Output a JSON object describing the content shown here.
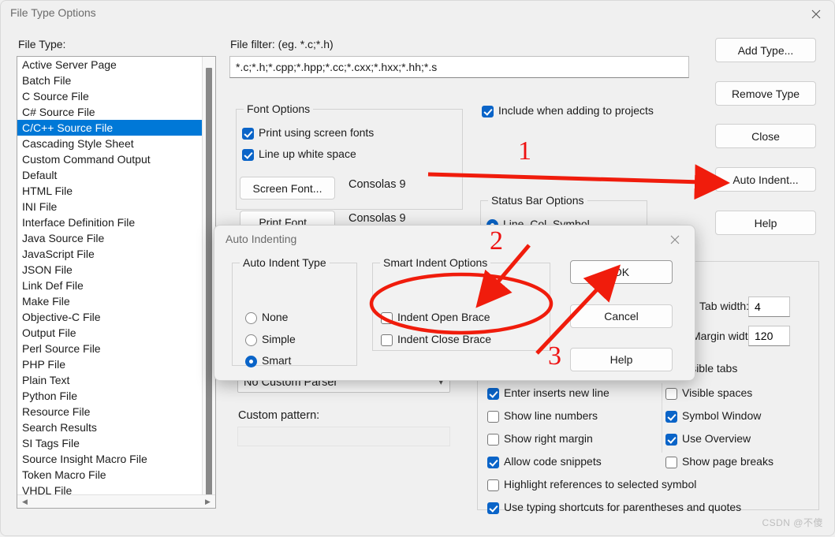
{
  "window": {
    "title": "File Type Options",
    "close_icon": "close-icon"
  },
  "file_type": {
    "label": "File Type:",
    "items": [
      "Active Server Page",
      "Batch File",
      "C Source File",
      "C# Source File",
      "C/C++ Source File",
      "Cascading Style Sheet",
      "Custom Command Output",
      "Default",
      "HTML File",
      "INI File",
      "Interface Definition File",
      "Java Source File",
      "JavaScript File",
      "JSON File",
      "Link Def File",
      "Make File",
      "Objective-C File",
      "Output File",
      "Perl Source File",
      "PHP File",
      "Plain Text",
      "Python File",
      "Resource File",
      "Search Results",
      "SI Tags File",
      "Source Insight Macro File",
      "Token Macro File",
      "VHDL File"
    ],
    "selected": "C/C++ Source File",
    "selected_index": 4,
    "scroll_left_arrow": "◀",
    "scroll_right_arrow": "▶"
  },
  "filter": {
    "label": "File filter: (eg. *.c;*.h)",
    "value": "*.c;*.h;*.cpp;*.hpp;*.cc;*.cxx;*.hxx;*.hh;*.s"
  },
  "include_projects": {
    "label": "Include when adding to projects",
    "checked": true
  },
  "font_options": {
    "title": "Font Options",
    "print_screen_fonts": {
      "label": "Print using screen fonts",
      "checked": true
    },
    "line_up_white_space": {
      "label": "Line up white space",
      "checked": true
    },
    "screen_font_button": "Screen Font...",
    "screen_font_value": "Consolas 9",
    "print_font_button": "Print Font...",
    "print_font_value": "Consolas 9"
  },
  "status_bar_options": {
    "title": "Status Bar Options",
    "option_line_col_symbol": {
      "label": "Line, Col, Symbol",
      "selected": true
    }
  },
  "parser": {
    "selected": "No Custom Parser",
    "chevron_icon": "chevron-down-icon",
    "custom_pattern_label": "Custom pattern:",
    "custom_pattern_value": ""
  },
  "editing_options": {
    "column_left": [
      {
        "label": "Enter inserts new line",
        "checked": true
      },
      {
        "label": "Show line numbers",
        "checked": false
      },
      {
        "label": "Show right margin",
        "checked": false
      },
      {
        "label": "Allow code snippets",
        "checked": true
      }
    ],
    "column_right": [
      {
        "label": "Visible spaces",
        "checked": false
      },
      {
        "label": "Symbol Window",
        "checked": true
      },
      {
        "label": "Use Overview",
        "checked": true
      },
      {
        "label": "Show page breaks",
        "checked": false
      }
    ],
    "full_width": [
      {
        "label": "Highlight references to selected symbol",
        "checked": false
      },
      {
        "label": "Use typing shortcuts for parentheses and quotes",
        "checked": true
      }
    ],
    "tab_width_label": "Tab width:",
    "tab_width_value": "4",
    "margin_width_label": "Margin width:",
    "margin_width_value": "120",
    "visible_tabs": {
      "label": "Visible tabs",
      "checked": false
    }
  },
  "side_buttons": {
    "add_type": "Add Type...",
    "remove_type": "Remove Type",
    "close": "Close",
    "auto_indent": "Auto Indent...",
    "help": "Help"
  },
  "dialog": {
    "title": "Auto Indenting",
    "close_icon": "close-icon",
    "auto_indent_type": {
      "title": "Auto Indent Type",
      "options": [
        {
          "label": "None",
          "selected": false
        },
        {
          "label": "Simple",
          "selected": false
        },
        {
          "label": "Smart",
          "selected": true
        }
      ]
    },
    "smart_indent_options": {
      "title": "Smart Indent Options",
      "options": [
        {
          "label": "Indent Open Brace",
          "checked": false
        },
        {
          "label": "Indent Close Brace",
          "checked": false
        }
      ]
    },
    "buttons": {
      "ok": "OK",
      "cancel": "Cancel",
      "help": "Help"
    }
  },
  "annotations": {
    "color": "#ee1111",
    "step1": "1",
    "step2": "2",
    "step3": "3"
  },
  "watermark": "CSDN @不傻"
}
